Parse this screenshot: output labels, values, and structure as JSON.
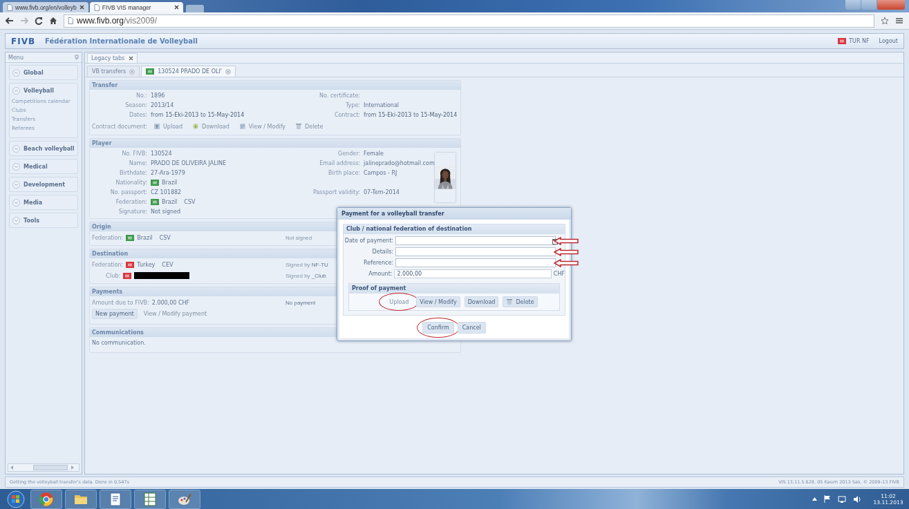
{
  "browser": {
    "tabs": [
      {
        "label": "www.fivb.org/en/volleyb",
        "selected": false
      },
      {
        "label": "FIVB VIS manager",
        "selected": true
      }
    ],
    "url": {
      "host": "www.fivb.org",
      "path": "/vis2009/"
    },
    "forward_disabled": true
  },
  "app": {
    "logo": "FIVB",
    "title": "Fédération Internationale de Volleyball",
    "user": "TUR NF",
    "user_flag": {
      "color": "#d9363e"
    },
    "logout": "Logout"
  },
  "menu": {
    "title": "Menu",
    "sections": [
      {
        "label": "Global",
        "expanded": false
      },
      {
        "label": "Volleyball",
        "expanded": true,
        "items": [
          "Competitions calendar",
          "Clubs",
          "Transfers",
          "Referees"
        ]
      },
      {
        "label": "Beach volleyball",
        "expanded": false
      },
      {
        "label": "Medical",
        "expanded": false
      },
      {
        "label": "Development",
        "expanded": false
      },
      {
        "label": "Media",
        "expanded": false
      },
      {
        "label": "Tools",
        "expanded": false
      }
    ]
  },
  "legacy_tab": {
    "label": "Legacy tabs"
  },
  "tabs": [
    {
      "label": "VB transfers",
      "selected": false
    },
    {
      "label": "130524 PRADO DE OLI'",
      "flag": {
        "color": "#3d9a4a"
      },
      "selected": true
    }
  ],
  "transfer": {
    "title": "Transfer",
    "rows": [
      {
        "left": {
          "label": "No.:",
          "value": "1896"
        },
        "right": {
          "label": "No. certificate:"
        }
      },
      {
        "left": {
          "label": "Season:",
          "value": "2013/14"
        },
        "right": {
          "label": "Type:",
          "value": "International"
        }
      },
      {
        "left": {
          "label": "Dates:",
          "value": "from **15-Eki-2013**  to **15-May-2014**"
        },
        "right": {
          "label": "Contract:",
          "value": "from **15-Eki-2013**  to **15-May-2014**"
        }
      }
    ],
    "document": {
      "label": "Contract document:",
      "actions": [
        {
          "label": "Upload",
          "kind": "upload",
          "disabled": true
        },
        {
          "label": "Download",
          "kind": "download",
          "disabled": true
        },
        {
          "label": "View / Modify",
          "kind": "view",
          "disabled": true
        },
        {
          "label": "Delete",
          "kind": "delete",
          "disabled": true
        }
      ]
    }
  },
  "player": {
    "title": "Player",
    "rows": [
      {
        "left": {
          "label": "No. FIVB:",
          "value": "130524"
        },
        "right": {
          "label": "Gender:",
          "value": "Female"
        }
      },
      {
        "left": {
          "label": "Name:",
          "value": "PRADO DE OLIVEIRA JALINE"
        },
        "right": {
          "label": "Email address:",
          "value": "jalineprado@hotmail.com"
        }
      },
      {
        "left": {
          "label": "Birthdate:",
          "value": "27-Ara-1979"
        },
        "right": {
          "label": "Birth place:",
          "value": "Campos - RJ"
        }
      },
      {
        "left": {
          "label": "Nationality:",
          "flag": {
            "color": "#3d9a4a"
          },
          "value": "Brazil"
        }
      },
      {
        "left": {
          "label": "No. passport:",
          "value": "CZ 101882"
        },
        "right": {
          "label": "Passport validity:",
          "value": "07-Tem-2014"
        }
      },
      {
        "left": {
          "label": "Federation:",
          "flag": {
            "color": "#3d9a4a"
          },
          "value": "Brazil",
          "code": "CSV"
        }
      },
      {
        "left": {
          "label": "Signature:",
          "value": "Not signed"
        }
      }
    ]
  },
  "origin": {
    "title": "Origin",
    "rows": [
      {
        "label": "Federation:",
        "flag": {
          "color": "#3d9a4a"
        },
        "value": "Brazil",
        "code": "CSV",
        "status": "Not signed"
      }
    ]
  },
  "destination": {
    "title": "Destination",
    "rows": [
      {
        "label": "Federation:",
        "flag": {
          "color": "#d9363e"
        },
        "value": "Turkey",
        "code": "CEV",
        "status": "Signed by **NF-TU**"
      },
      {
        "label": "Club:",
        "flag": {
          "color": "#d9363e"
        },
        "redacted": true,
        "status": "Signed by **_Club**"
      }
    ]
  },
  "payments": {
    "title": "Payments",
    "label": "Amount due to FIVB:",
    "value": "2.000,00 CHF",
    "status": "No payment",
    "buttons": [
      {
        "label": "New payment",
        "disabled": false
      },
      {
        "label": "View / Modify payment",
        "disabled": true
      }
    ]
  },
  "communications": {
    "title": "Communications",
    "text": "No communication."
  },
  "dialog": {
    "title": "Payment for a volleyball transfer",
    "section": "Club / national federation of destination",
    "fields": [
      {
        "label": "Date of payment:",
        "kind": "date",
        "annotated": true
      },
      {
        "label": "Details:",
        "kind": "text",
        "annotated": true
      },
      {
        "label": "Reference:",
        "kind": "text",
        "annotated": true
      },
      {
        "label": "Amount:",
        "kind": "text",
        "value": "2.000,00",
        "unit": "CHF",
        "annotated": false
      }
    ],
    "proof": {
      "title": "Proof of payment",
      "actions": [
        {
          "label": "Upload",
          "kind": "upload",
          "disabled": true,
          "circled": true
        },
        {
          "label": "View / Modify",
          "kind": "view",
          "disabled": false,
          "circled": false
        },
        {
          "label": "Download",
          "kind": "download",
          "disabled": false,
          "circled": false
        },
        {
          "label": "Delete",
          "kind": "delete",
          "disabled": false,
          "circled": false
        }
      ]
    },
    "buttons": [
      {
        "label": "Confirm",
        "circled": true
      },
      {
        "label": "Cancel",
        "circled": false
      }
    ]
  },
  "status_bar": {
    "left": "Getting the volleyball transfer's data. Done in 0,547s",
    "right": "VIS 13.11.5.628, 05 Kasım 2013 Salı, © 2009-13 FIVB"
  },
  "taskbar": {
    "time": "11:02",
    "date": "13.11.2013"
  }
}
